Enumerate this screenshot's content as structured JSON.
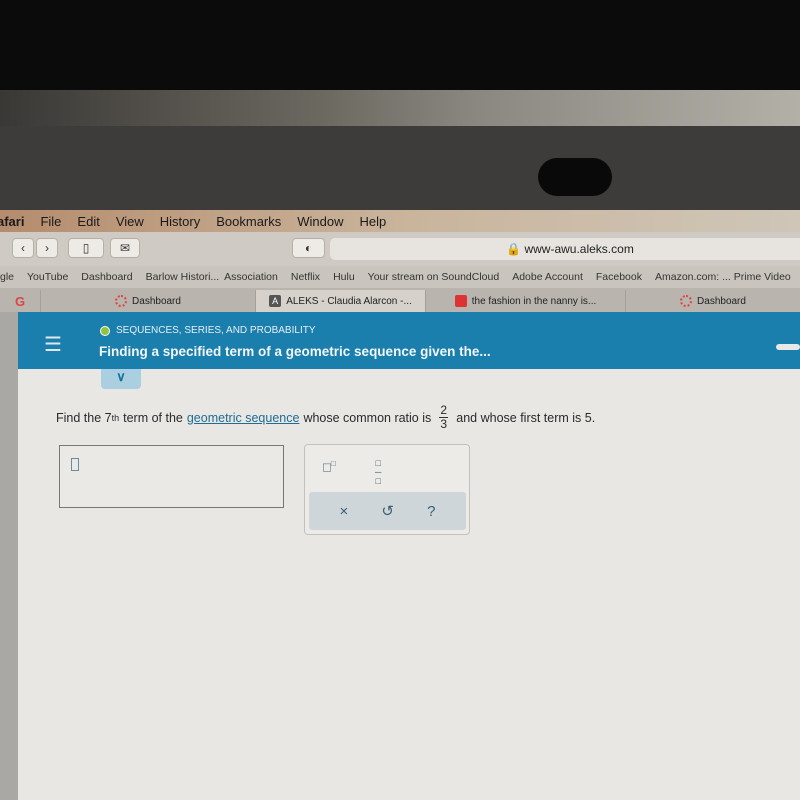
{
  "menubar": {
    "app": "afari",
    "items": [
      "File",
      "Edit",
      "View",
      "History",
      "Bookmarks",
      "Window",
      "Help"
    ]
  },
  "toolbar": {
    "back": "‹",
    "forward": "›",
    "url": "www-awu.aleks.com"
  },
  "bookmarks": [
    "gle",
    "YouTube",
    "Dashboard",
    "Barlow Histori...",
    "Association",
    "Netflix",
    "Hulu",
    "Your stream on SoundCloud",
    "Adobe Account",
    "Facebook",
    "Amazon.com: ... Prime Video"
  ],
  "tabs": [
    {
      "label": "G"
    },
    {
      "label": "Dashboard"
    },
    {
      "label": "ALEKS - Claudia Alarcon -..."
    },
    {
      "label": "the fashion in the nanny is..."
    },
    {
      "label": "Dashboard"
    }
  ],
  "header": {
    "category": "SEQUENCES, SERIES, AND PROBABILITY",
    "title": "Finding a specified term of a geometric sequence given the..."
  },
  "question": {
    "prefix": "Find the 7",
    "sup": "th",
    "middle": "term of the",
    "link": "geometric sequence",
    "after_link": "whose common ratio is",
    "ratio_num": "2",
    "ratio_den": "3",
    "suffix": "and whose first term is 5."
  },
  "pad": {
    "clear": "×",
    "undo": "↺",
    "help": "?"
  },
  "colors": {
    "header": "#1b7fae",
    "link": "#1f6c95",
    "status_dot": "#8fc43d"
  }
}
